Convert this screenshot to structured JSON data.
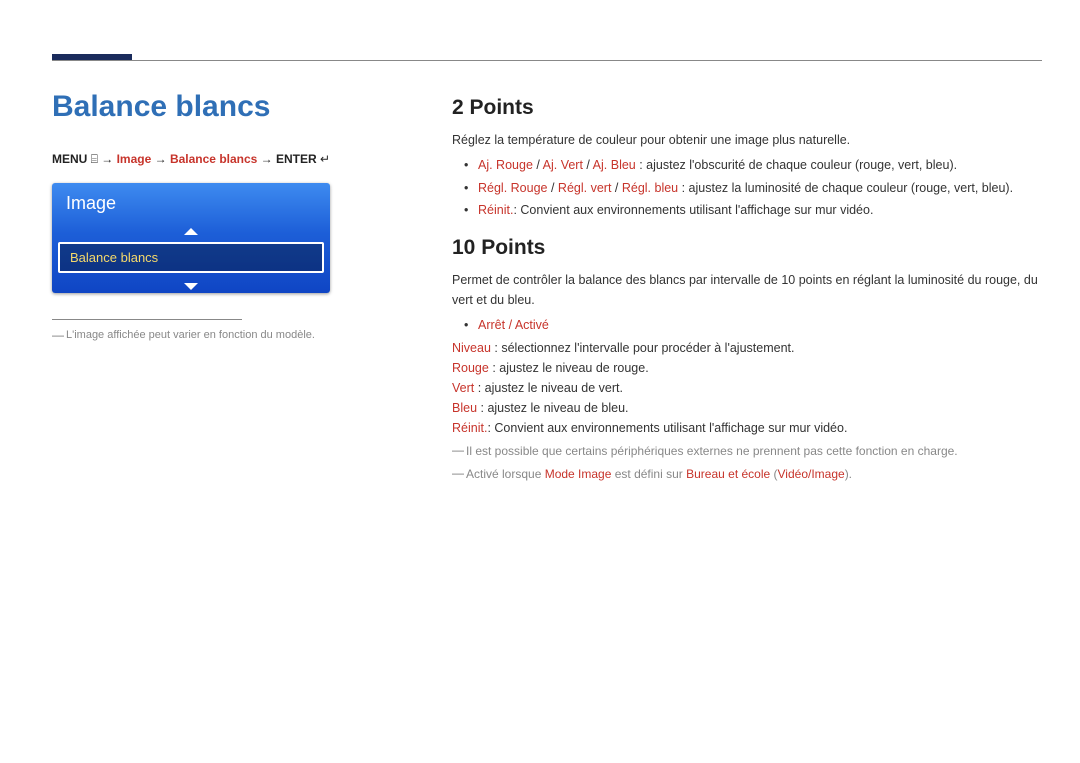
{
  "titles": {
    "page": "Balance blancs",
    "section1": "2 Points",
    "section2": "10 Points"
  },
  "breadcrumb": {
    "label_menu": "MENU",
    "glyph_menu": "⌸",
    "arrow": "→",
    "step1": "Image",
    "step2": "Balance blancs",
    "label_enter": "ENTER",
    "glyph_enter": "↵"
  },
  "menu_card": {
    "header": "Image",
    "selected": "Balance blancs"
  },
  "left_footnote": "L'image affichée peut varier en fonction du modèle.",
  "section1": {
    "intro": "Réglez la température de couleur pour obtenir une image plus naturelle.",
    "b1_lead1": "Aj. Rouge",
    "b1_sep": " / ",
    "b1_lead2": "Aj. Vert",
    "b1_lead3": "Aj. Bleu",
    "b1_rest": " : ajustez l'obscurité de chaque couleur (rouge, vert, bleu).",
    "b2_lead1": "Régl. Rouge",
    "b2_lead2": "Régl. vert",
    "b2_lead3": "Régl. bleu",
    "b2_rest": " : ajustez la luminosité de chaque couleur (rouge, vert, bleu).",
    "b3_lead": "Réinit.",
    "b3_rest": ": Convient aux environnements utilisant l'affichage sur mur vidéo."
  },
  "section2": {
    "intro": "Permet de contrôler la balance des blancs par intervalle de 10 points en réglant la luminosité du rouge, du vert et du bleu.",
    "b1_a": "Arrêt",
    "b1_sep": " / ",
    "b1_b": "Activé",
    "l_niveau_lead": "Niveau",
    "l_niveau_rest": " : sélectionnez l'intervalle pour procéder à l'ajustement.",
    "l_rouge_lead": "Rouge",
    "l_rouge_rest": " : ajustez le niveau de rouge.",
    "l_vert_lead": "Vert",
    "l_vert_rest": " : ajustez le niveau de vert.",
    "l_bleu_lead": "Bleu",
    "l_bleu_rest": " : ajustez le niveau de bleu.",
    "l_reinit_lead": "Réinit.",
    "l_reinit_rest": ": Convient aux environnements utilisant l'affichage sur mur vidéo.",
    "note1": "Il est possible que certains périphériques externes ne prennent pas cette fonction en charge.",
    "note2_a": "Activé lorsque ",
    "note2_b": "Mode Image",
    "note2_c": " est défini sur ",
    "note2_d": "Bureau et école",
    "note2_e": " (",
    "note2_f": "Vidéo/Image",
    "note2_g": ")."
  }
}
